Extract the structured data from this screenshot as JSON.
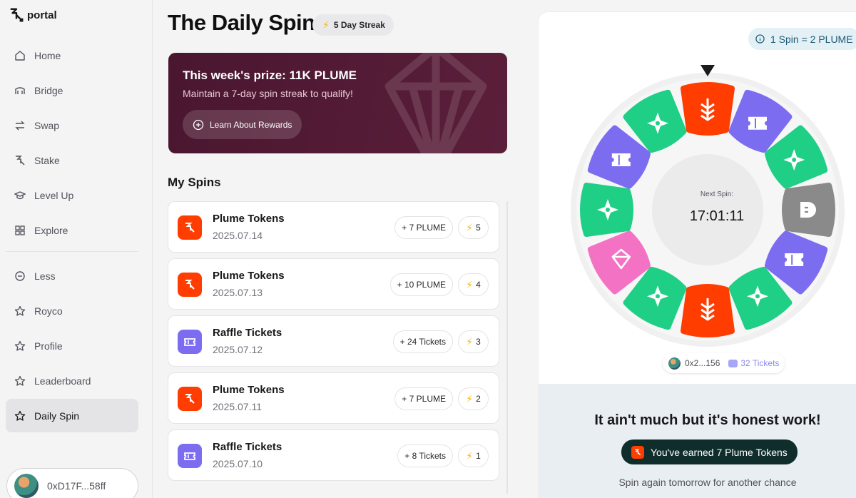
{
  "brand": {
    "name": "portal"
  },
  "sidebar": {
    "items": [
      {
        "label": "Home",
        "icon": "home-icon"
      },
      {
        "label": "Bridge",
        "icon": "bridge-icon"
      },
      {
        "label": "Swap",
        "icon": "swap-icon"
      },
      {
        "label": "Stake",
        "icon": "stake-icon"
      },
      {
        "label": "Level Up",
        "icon": "graduation-cap-icon"
      },
      {
        "label": "Explore",
        "icon": "grid-icon"
      }
    ],
    "secondary_items": [
      {
        "label": "Less",
        "icon": "minus-circle-icon"
      },
      {
        "label": "Royco",
        "icon": "star-icon"
      },
      {
        "label": "Profile",
        "icon": "star-icon"
      },
      {
        "label": "Leaderboard",
        "icon": "star-icon"
      },
      {
        "label": "Daily Spin",
        "icon": "star-icon",
        "active": true
      }
    ],
    "wallet": "0xD17F...58ff"
  },
  "header": {
    "title": "The Daily Spin",
    "streak": "5 Day Streak"
  },
  "prize": {
    "title": "This week's prize: 11K PLUME",
    "subtitle": "Maintain a 7-day spin streak to qualify!",
    "button": "Learn About Rewards"
  },
  "my_spins": {
    "title": "My Spins",
    "rows": [
      {
        "name": "Plume Tokens",
        "date": "2025.07.14",
        "amount": "+ 7 PLUME",
        "streak": "5",
        "kind": "plume"
      },
      {
        "name": "Plume Tokens",
        "date": "2025.07.13",
        "amount": "+ 10 PLUME",
        "streak": "4",
        "kind": "plume"
      },
      {
        "name": "Raffle Tickets",
        "date": "2025.07.12",
        "amount": "+ 24 Tickets",
        "streak": "3",
        "kind": "ticket"
      },
      {
        "name": "Plume Tokens",
        "date": "2025.07.11",
        "amount": "+ 7 PLUME",
        "streak": "2",
        "kind": "plume"
      },
      {
        "name": "Raffle Tickets",
        "date": "2025.07.10",
        "amount": "+ 8 Tickets",
        "streak": "1",
        "kind": "ticket"
      }
    ]
  },
  "wheel": {
    "rate": "1 Spin = 2 PLUME",
    "next_label": "Next Spin:",
    "countdown": "17:01:11",
    "segments": [
      "plume",
      "ticket",
      "star",
      "gray",
      "ticket",
      "star",
      "plume",
      "star",
      "gem",
      "star",
      "ticket",
      "star"
    ],
    "wallet_short": "0x2...156",
    "tickets": "32 Tickets"
  },
  "result": {
    "title": "It ain't much but it's honest work!",
    "earned": "You've earned 7 Plume Tokens",
    "subtitle": "Spin again tomorrow for another chance"
  },
  "colors": {
    "plume": "#ff3d00",
    "ticket": "#7c6cf0",
    "star": "#1fcf85",
    "gem": "#f472c4",
    "gray": "#8a8a8a",
    "prize_bg": "#4a1630",
    "streak_bolt": "#f5b80b"
  }
}
